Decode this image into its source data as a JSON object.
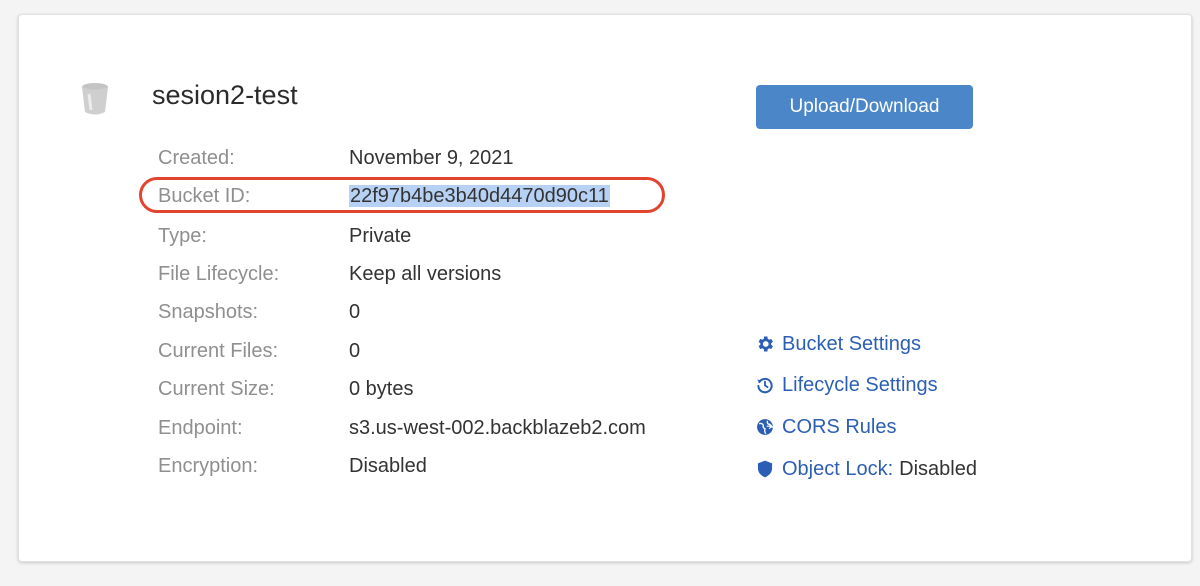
{
  "bucket": {
    "name": "sesion2-test",
    "upload_label": "Upload/Download"
  },
  "details": [
    {
      "label": "Created:",
      "value": "November 9, 2021"
    },
    {
      "label": "Bucket ID:",
      "value": "22f97b4be3b40d4470d90c11"
    },
    {
      "label": "Type:",
      "value": "Private"
    },
    {
      "label": "File Lifecycle:",
      "value": "Keep all versions"
    },
    {
      "label": "Snapshots:",
      "value": "0"
    },
    {
      "label": "Current Files:",
      "value": "0"
    },
    {
      "label": "Current Size:",
      "value": "0 bytes"
    },
    {
      "label": "Endpoint:",
      "value": "s3.us-west-002.backblazeb2.com"
    },
    {
      "label": "Encryption:",
      "value": "Disabled"
    }
  ],
  "links": {
    "bucket_settings": {
      "label": "Bucket Settings",
      "icon": "gear-icon"
    },
    "lifecycle_settings": {
      "label": "Lifecycle Settings",
      "icon": "history-icon"
    },
    "cors_rules": {
      "label": "CORS Rules",
      "icon": "globe-icon"
    },
    "object_lock": {
      "label": "Object Lock:",
      "status": "Disabled",
      "icon": "shield-icon"
    }
  },
  "colors": {
    "link": "#2c5fb3",
    "button": "#4a86c8",
    "highlight_ring": "#e2452f",
    "selection": "#b7d1f4"
  }
}
